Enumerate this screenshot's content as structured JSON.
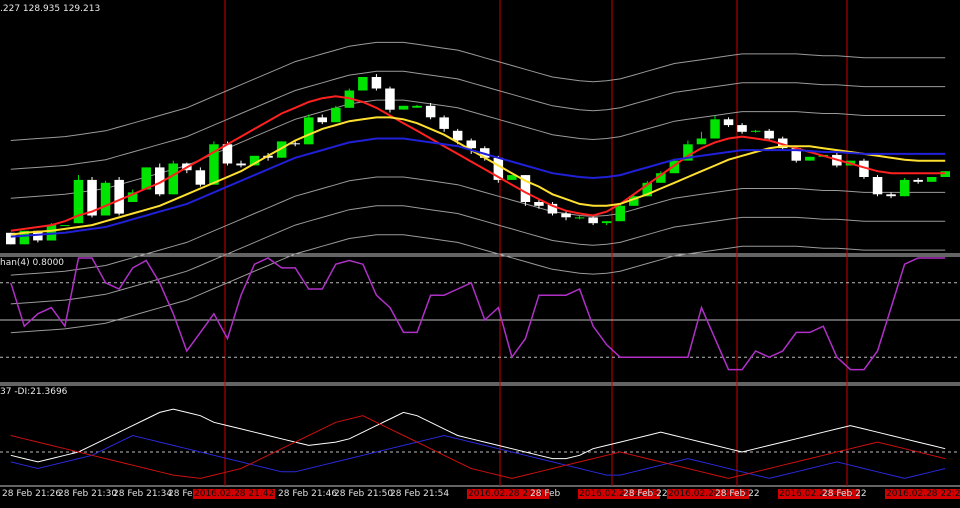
{
  "window": {
    "price_info": ".227 128.935 129.213",
    "stoch_info": "han(4) 0.8000",
    "adx_info": "37 -DI:21.3696"
  },
  "colors": {
    "background": "#000000",
    "bull_candle": "#00e400",
    "bear_candle": "#ffffff",
    "ma_fast": "#ff2020",
    "ma_mid": "#ffe030",
    "ma_slow": "#2020d8",
    "bands": "#9a9a9a",
    "oscillator": "#b030c8",
    "plus_di": "#ffffff",
    "minus_di": "#2a2adc",
    "adx_red": "#cc1010",
    "vertical_marker": "#cc0000",
    "axis_text": "#e0e0e0"
  },
  "time_axis": {
    "labels": [
      {
        "text": "28 Feb 21:26",
        "highlight": false
      },
      {
        "text": "28 Feb 21:30",
        "highlight": false
      },
      {
        "text": "28 Feb 21:34",
        "highlight": false
      },
      {
        "text": "28 Feb",
        "highlight": false
      },
      {
        "text": "2016.02.28 21:42",
        "highlight": true
      },
      {
        "text": "28 Feb 21:46",
        "highlight": false
      },
      {
        "text": "28 Feb 21:50",
        "highlight": false
      },
      {
        "text": "28 Feb 21:54",
        "highlight": false
      },
      {
        "text": "2016.02.28 21:57",
        "highlight": true
      },
      {
        "text": "28 Feb",
        "highlight": false
      },
      {
        "text": "2016.02.28 22:03",
        "highlight": true
      },
      {
        "text": "28 Feb 22",
        "highlight": false
      },
      {
        "text": "2016.02.28 22:10",
        "highlight": true
      },
      {
        "text": "28 Feb 22",
        "highlight": false
      },
      {
        "text": "2016.02.28 22:17",
        "highlight": true
      },
      {
        "text": "28 Feb 22",
        "highlight": false
      },
      {
        "text": "2016.02.28 22:2",
        "highlight": true
      }
    ]
  },
  "chart_data": [
    {
      "type": "candlestick",
      "title": "",
      "candles": [
        [
          20,
          20,
          8,
          8
        ],
        [
          8,
          8,
          22,
          22
        ],
        [
          22,
          22,
          12,
          10
        ],
        [
          12,
          14,
          28,
          30
        ],
        [
          28,
          28,
          28,
          28
        ],
        [
          30,
          30,
          75,
          80
        ],
        [
          75,
          78,
          38,
          36
        ],
        [
          38,
          40,
          72,
          74
        ],
        [
          75,
          78,
          40,
          38
        ],
        [
          52,
          55,
          62,
          65
        ],
        [
          65,
          70,
          88,
          86
        ],
        [
          88,
          92,
          60,
          58
        ],
        [
          60,
          63,
          92,
          95
        ],
        [
          92,
          93,
          85,
          82
        ],
        [
          85,
          88,
          70,
          68
        ],
        [
          70,
          75,
          112,
          115
        ],
        [
          112,
          115,
          92,
          90
        ],
        [
          92,
          95,
          90,
          88
        ],
        [
          90,
          92,
          100,
          98
        ],
        [
          100,
          103,
          98,
          95
        ],
        [
          98,
          103,
          115,
          113
        ],
        [
          113,
          116,
          112,
          110
        ],
        [
          112,
          116,
          140,
          143
        ],
        [
          140,
          143,
          135,
          133
        ],
        [
          135,
          139,
          150,
          152
        ],
        [
          150,
          155,
          168,
          170
        ],
        [
          168,
          171,
          182,
          180
        ],
        [
          182,
          185,
          170,
          168
        ],
        [
          170,
          172,
          148,
          145
        ],
        [
          148,
          150,
          152,
          150
        ],
        [
          150,
          153,
          152,
          150
        ],
        [
          152,
          155,
          140,
          138
        ],
        [
          140,
          142,
          128,
          125
        ],
        [
          126,
          128,
          116,
          112
        ],
        [
          116,
          118,
          108,
          102
        ],
        [
          108,
          110,
          98,
          95
        ],
        [
          98,
          100,
          75,
          72
        ],
        [
          75,
          78,
          80,
          77
        ],
        [
          80,
          80,
          52,
          48
        ],
        [
          52,
          55,
          48,
          45
        ],
        [
          50,
          52,
          40,
          38
        ],
        [
          40,
          42,
          36,
          33
        ],
        [
          36,
          38,
          36,
          34
        ],
        [
          36,
          38,
          30,
          28
        ],
        [
          30,
          32,
          32,
          28
        ],
        [
          32,
          36,
          48,
          50
        ],
        [
          48,
          50,
          58,
          60
        ],
        [
          58,
          62,
          72,
          74
        ],
        [
          72,
          75,
          82,
          84
        ],
        [
          82,
          86,
          95,
          97
        ],
        [
          95,
          98,
          112,
          116
        ],
        [
          112,
          116,
          118,
          125
        ],
        [
          118,
          120,
          138,
          142
        ],
        [
          138,
          140,
          132,
          130
        ],
        [
          132,
          134,
          125,
          123
        ],
        [
          125,
          127,
          126,
          124
        ],
        [
          126,
          128,
          118,
          116
        ],
        [
          118,
          120,
          108,
          106
        ],
        [
          108,
          110,
          95,
          93
        ],
        [
          95,
          97,
          99,
          97
        ],
        [
          99,
          101,
          101,
          99
        ],
        [
          101,
          103,
          90,
          88
        ],
        [
          90,
          92,
          95,
          93
        ],
        [
          95,
          97,
          78,
          76
        ],
        [
          78,
          80,
          60,
          58
        ],
        [
          60,
          62,
          58,
          56
        ],
        [
          58,
          60,
          75,
          77
        ],
        [
          75,
          77,
          73,
          71
        ],
        [
          73,
          75,
          78,
          76
        ],
        [
          78,
          80,
          84,
          82
        ]
      ],
      "series": [
        {
          "values": [
            22,
            24,
            26,
            28,
            32,
            38,
            42,
            48,
            54,
            60,
            66,
            72,
            80,
            88,
            96,
            104,
            112,
            120,
            128,
            136,
            144,
            150,
            156,
            160,
            162,
            160,
            156,
            150,
            142,
            134,
            126,
            118,
            110,
            102,
            94,
            86,
            78,
            70,
            62,
            55,
            48,
            43,
            40,
            38,
            42,
            50,
            60,
            70,
            80,
            90,
            100,
            108,
            114,
            118,
            120,
            118,
            116,
            112,
            108,
            104,
            100,
            96,
            92,
            88,
            84,
            82,
            82,
            82,
            82,
            82
          ]
        },
        {
          "values": [
            18,
            20,
            21,
            22,
            24,
            26,
            28,
            32,
            36,
            40,
            44,
            48,
            54,
            60,
            66,
            72,
            78,
            84,
            92,
            100,
            108,
            116,
            122,
            128,
            132,
            136,
            138,
            140,
            140,
            138,
            134,
            128,
            122,
            114,
            106,
            98,
            90,
            82,
            74,
            68,
            60,
            55,
            50,
            48,
            48,
            50,
            55,
            60,
            66,
            72,
            78,
            84,
            90,
            96,
            100,
            104,
            108,
            110,
            110,
            110,
            108,
            106,
            104,
            102,
            100,
            98,
            96,
            95,
            95,
            95
          ]
        },
        {
          "values": [
            16,
            17,
            18,
            19,
            20,
            22,
            24,
            26,
            30,
            34,
            38,
            42,
            46,
            50,
            56,
            62,
            68,
            74,
            80,
            86,
            92,
            98,
            102,
            106,
            110,
            114,
            116,
            118,
            118,
            118,
            116,
            114,
            112,
            110,
            106,
            102,
            98,
            94,
            90,
            86,
            82,
            80,
            78,
            77,
            78,
            80,
            84,
            88,
            92,
            96,
            98,
            100,
            102,
            104,
            106,
            106,
            106,
            106,
            106,
            105,
            104,
            104,
            103,
            102,
            102,
            102,
            102,
            102,
            102,
            102
          ]
        }
      ],
      "ylim": [
        0,
        260
      ]
    },
    {
      "type": "line",
      "title": "",
      "series": [
        {
          "values": [
            80,
            45,
            55,
            60,
            45,
            115,
            100,
            80,
            75,
            92,
            98,
            80,
            55,
            25,
            40,
            55,
            35,
            70,
            95,
            115,
            92,
            92,
            75,
            75,
            95,
            98,
            95,
            70,
            60,
            40,
            40,
            70,
            70,
            75,
            80,
            50,
            60,
            20,
            35,
            70,
            70,
            70,
            75,
            45,
            30,
            20,
            20,
            20,
            20,
            20,
            20,
            60,
            35,
            10,
            10,
            25,
            20,
            25,
            40,
            40,
            45,
            20,
            10,
            10,
            25,
            60,
            95,
            110,
            110,
            100
          ]
        }
      ],
      "ylim": [
        0,
        100
      ]
    },
    {
      "type": "line",
      "title": "",
      "series": [
        {
          "values": [
            18,
            16,
            14,
            16,
            18,
            20,
            24,
            28,
            32,
            36,
            40,
            44,
            46,
            44,
            42,
            38,
            36,
            34,
            32,
            30,
            28,
            26,
            24,
            25,
            26,
            28,
            32,
            36,
            40,
            44,
            42,
            38,
            34,
            30,
            28,
            26,
            24,
            22,
            20,
            18,
            16,
            16,
            18,
            22,
            24,
            26,
            28,
            30,
            32,
            30,
            28,
            26,
            24,
            22,
            20,
            22,
            24,
            26,
            28,
            30,
            32,
            34,
            36,
            34,
            32,
            30,
            28,
            26,
            24,
            22
          ]
        },
        {
          "values": [
            14,
            12,
            10,
            12,
            14,
            16,
            18,
            22,
            26,
            30,
            28,
            26,
            24,
            22,
            20,
            18,
            16,
            14,
            12,
            10,
            8,
            8,
            10,
            12,
            14,
            16,
            18,
            20,
            22,
            24,
            26,
            28,
            30,
            28,
            26,
            24,
            22,
            20,
            18,
            16,
            14,
            12,
            10,
            8,
            6,
            6,
            8,
            10,
            12,
            14,
            16,
            14,
            12,
            10,
            8,
            6,
            4,
            6,
            8,
            10,
            12,
            14,
            12,
            10,
            8,
            6,
            4,
            6,
            8,
            10
          ]
        },
        {
          "values": [
            30,
            28,
            26,
            24,
            22,
            20,
            18,
            16,
            14,
            12,
            10,
            8,
            6,
            5,
            4,
            6,
            8,
            10,
            14,
            18,
            22,
            26,
            30,
            34,
            38,
            40,
            42,
            38,
            34,
            30,
            26,
            22,
            18,
            14,
            10,
            8,
            6,
            4,
            6,
            8,
            10,
            12,
            14,
            16,
            18,
            20,
            18,
            16,
            14,
            12,
            10,
            8,
            6,
            4,
            6,
            8,
            10,
            12,
            14,
            16,
            18,
            20,
            22,
            24,
            26,
            24,
            22,
            20,
            18,
            16
          ]
        }
      ],
      "ylim": [
        0,
        60
      ]
    }
  ]
}
